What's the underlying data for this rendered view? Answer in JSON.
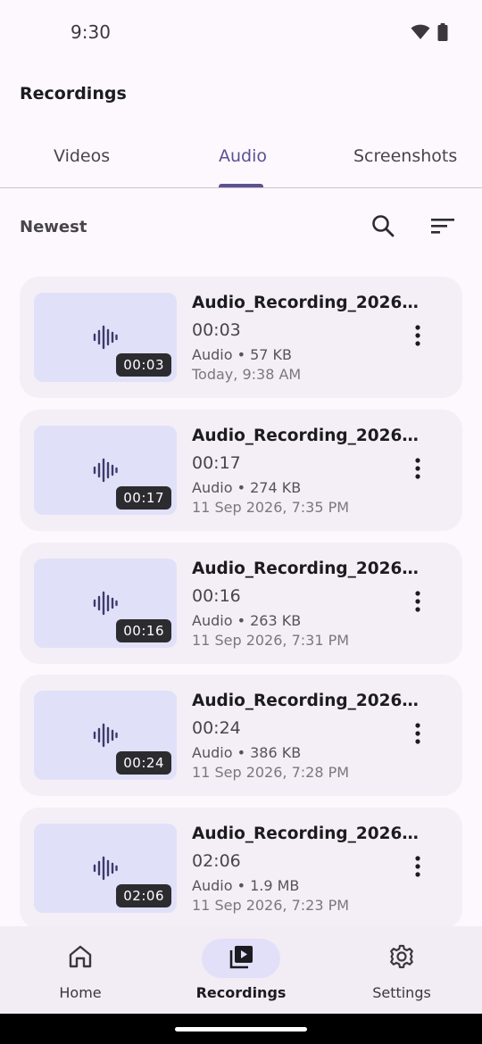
{
  "status_bar": {
    "time": "9:30",
    "icons": [
      "wifi-icon",
      "battery-icon"
    ]
  },
  "page_title": "Recordings",
  "tabs": [
    {
      "label": "Videos",
      "active": false
    },
    {
      "label": "Audio",
      "active": true
    },
    {
      "label": "Screenshots",
      "active": false
    }
  ],
  "sort": {
    "label": "Newest",
    "icons": [
      "search-icon",
      "sort-icon"
    ]
  },
  "recordings": [
    {
      "title": "Audio_Recording_2026…",
      "duration": "00:03",
      "meta": "Audio • 57 KB",
      "date": "Today, 9:38 AM",
      "badge": "00:03"
    },
    {
      "title": "Audio_Recording_2026…",
      "duration": "00:17",
      "meta": "Audio • 274 KB",
      "date": "11 Sep 2026, 7:35 PM",
      "badge": "00:17"
    },
    {
      "title": "Audio_Recording_2026…",
      "duration": "00:16",
      "meta": "Audio • 263 KB",
      "date": "11 Sep 2026, 7:31 PM",
      "badge": "00:16"
    },
    {
      "title": "Audio_Recording_2026…",
      "duration": "00:24",
      "meta": "Audio • 386 KB",
      "date": "11 Sep 2026, 7:28 PM",
      "badge": "00:24"
    },
    {
      "title": "Audio_Recording_2026…",
      "duration": "02:06",
      "meta": "Audio • 1.9 MB",
      "date": "11 Sep 2026, 7:23 PM",
      "badge": "02:06"
    }
  ],
  "bottom_nav": [
    {
      "label": "Home",
      "icon": "home-icon",
      "active": false
    },
    {
      "label": "Recordings",
      "icon": "recordings-icon",
      "active": true
    },
    {
      "label": "Settings",
      "icon": "gear-icon",
      "active": false
    }
  ],
  "colors": {
    "accent": "#5a5293",
    "background": "#fdf8fe",
    "card": "#f4eff6",
    "thumb": "#e0e0f9",
    "nav_active_pill": "#e2dff8"
  }
}
